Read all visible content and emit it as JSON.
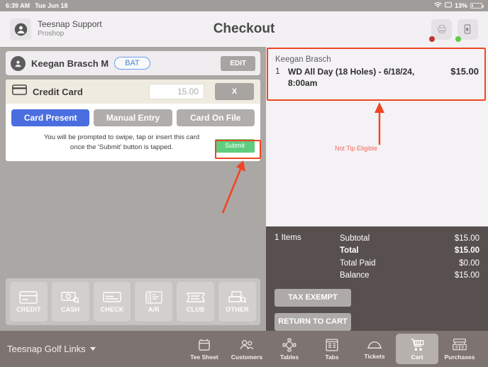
{
  "statusbar": {
    "time": "6:39 AM",
    "date": "Tue Jun 18",
    "wifi_icon": "wifi-icon",
    "airplay_icon": "screen-mirror-icon",
    "battery_percent": "13%"
  },
  "header": {
    "account_name": "Teesnap Support",
    "account_role": "Proshop",
    "title": "Checkout",
    "avatar_icon": "user-circle-icon",
    "printer_button": {
      "icon": "printer-icon",
      "status_color": "#c3352b"
    },
    "terminal_button": {
      "icon": "card-reader-icon",
      "status_color": "#5fcc45"
    }
  },
  "customer": {
    "avatar_icon": "person-icon",
    "name": "Keegan Brasch",
    "initial": "M",
    "badge": "BAT",
    "edit_label": "EDIT"
  },
  "payment": {
    "method_icon": "credit-card-icon",
    "method_title": "Credit Card",
    "amount_value": "15.00",
    "amount_placeholder": "0.00",
    "clear_label": "X",
    "tabs": [
      {
        "label": "Card Present",
        "active": true
      },
      {
        "label": "Manual Entry",
        "active": false
      },
      {
        "label": "Card On File",
        "active": false
      }
    ],
    "instruction_line1": "You will be prompted to swipe, tap or insert this card",
    "instruction_line2": "once the 'Submit' button is tapped.",
    "submit_label": "Submit"
  },
  "payment_types": [
    {
      "label": "CREDIT",
      "icon": "credit-card-icon"
    },
    {
      "label": "CASH",
      "icon": "cash-bill-icon"
    },
    {
      "label": "CHECK",
      "icon": "check-icon"
    },
    {
      "label": "A/R",
      "icon": "ledger-icon"
    },
    {
      "label": "CLUB",
      "icon": "club-ticket-icon"
    },
    {
      "label": "OTHER",
      "icon": "other-payment-icon"
    }
  ],
  "cart": {
    "group_name": "Keegan Brasch",
    "items": [
      {
        "qty": "1",
        "description": "WD All Day (18 Holes) - 6/18/24, 8:00am",
        "price": "$15.00"
      }
    ],
    "items_count": "1 Items",
    "totals": [
      {
        "label": "Subtotal",
        "value": "$15.00",
        "bold": false
      },
      {
        "label": "Total",
        "value": "$15.00",
        "bold": true
      },
      {
        "label": "Total Paid",
        "value": "$0.00",
        "bold": false
      },
      {
        "label": "Balance",
        "value": "$15.00",
        "bold": false
      }
    ],
    "tax_exempt_label": "TAX EXEMPT",
    "return_to_cart_label": "RETURN TO CART"
  },
  "annotations": {
    "cart_item_label": "Not Tip Eligible",
    "highlight_color": "#f04524",
    "label_color": "#f4695a"
  },
  "bottomnav": {
    "course": "Teesnap Golf Links",
    "items": [
      {
        "label": "Tee Sheet",
        "icon": "calendar-icon",
        "active": false
      },
      {
        "label": "Customers",
        "icon": "people-icon",
        "active": false
      },
      {
        "label": "Tables",
        "icon": "table-icon",
        "active": false
      },
      {
        "label": "Tabs",
        "icon": "tabs-icon",
        "active": false
      },
      {
        "label": "Tickets",
        "icon": "dome-cover-icon",
        "active": false
      },
      {
        "label": "Cart",
        "icon": "shopping-cart-icon",
        "active": true
      },
      {
        "label": "Purchases",
        "icon": "register-icon",
        "active": false
      }
    ]
  }
}
